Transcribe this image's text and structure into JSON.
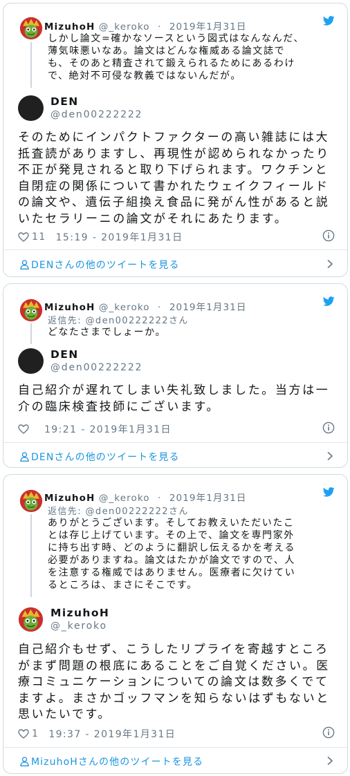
{
  "colors": {
    "link": "#1b95e0",
    "muted": "#657786",
    "border": "#cfd9de",
    "text": "#14171a"
  },
  "tweets": [
    {
      "parent": {
        "name": "MizuhoH",
        "handle": "@_keroko",
        "separator": "·",
        "date": "2019年1月31日",
        "text": "しかし論文=確かなソースという図式はなんなんだ、\n薄気味悪いなあ。論文はどんな権威ある論文誌で\nも、そのあと精査されて鍛えられるためにあるわけ\nで、絶対不可侵な教義ではないんだが。"
      },
      "author": {
        "name": "DEN",
        "handle": "@den00222222"
      },
      "text": "そのためにインパクトファクターの高い雑誌には大\n抵査読がありますし、再現性が認められなかったり\n不正が発見されると取り下げられます。ワクチンと\n自閉症の関係について書かれたウェイクフィールド\nの論文や、遺伝子組換え食品に発がん性があると説\nいたセラリーニの論文がそれにあたります。",
      "likes": "11",
      "time": "15:19 - 2019年1月31日",
      "more_label": "DENさんの他のツイートを見る",
      "icons": {
        "brand": "twitter-bird-icon",
        "like": "heart-icon",
        "info": "info-icon",
        "person": "person-icon",
        "arrow": "chevron-right-icon"
      }
    },
    {
      "parent": {
        "name": "MizuhoH",
        "handle": "@_keroko",
        "separator": "·",
        "date": "2019年1月31日",
        "reply_to": "返信先: @den00222222さん",
        "text": "どなたさまでしょーか。"
      },
      "author": {
        "name": "DEN",
        "handle": "@den00222222"
      },
      "text": "自己紹介が遅れてしまい失礼致しました。当方は一\n介の臨床検査技師にございます。",
      "likes": "",
      "time": "19:21 - 2019年1月31日",
      "more_label": "DENさんの他のツイートを見る"
    },
    {
      "parent": {
        "name": "MizuhoH",
        "handle": "@_keroko",
        "separator": "·",
        "date": "2019年1月31日",
        "reply_to": "返信先: @den00222222さん",
        "text": "ありがとうございます。そしてお教えいただいたこ\nとは存じ上げています。その上で、論文を専門家外\nに持ち出す時、どのように翻訳し伝えるかを考える\n必要がありますね。論文はたかが論文ですので、人\nを注意する権威ではありません。医療者に欠けてい\nるところは、まさにそこです。"
      },
      "author": {
        "name": "MizuhoH",
        "handle": "@_keroko"
      },
      "text": "自己紹介もせず、こうしたリプライを寄越すところ\nがまず問題の根底にあることをご自覚ください。医\n療コミュニケーションについての論文は数多くでて\nますよ。まさかゴッフマンを知らないはずもないと\n思いたいです。",
      "likes": "1",
      "time": "19:37 - 2019年1月31日",
      "more_label": "MizuhoHさんの他のツイートを見る"
    }
  ]
}
